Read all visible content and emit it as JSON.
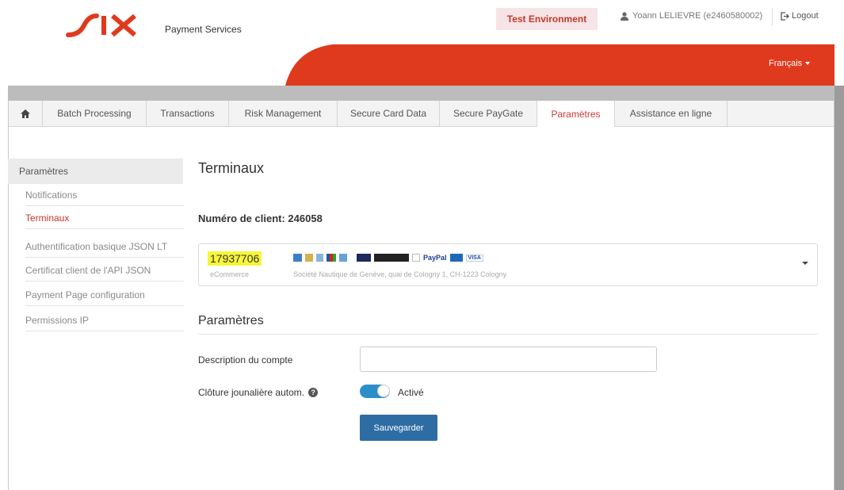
{
  "header": {
    "subtitle": "Payment Services",
    "environment": "Test Environment",
    "user": "Yoann LELIEVRE (e2460580002)",
    "logout": "Logout",
    "language": "Français"
  },
  "nav": {
    "tabs": [
      {
        "label": "Batch Processing",
        "active": false
      },
      {
        "label": "Transactions",
        "active": false
      },
      {
        "label": "Risk Management",
        "active": false
      },
      {
        "label": "Secure Card Data",
        "active": false
      },
      {
        "label": "Secure PayGate",
        "active": false
      },
      {
        "label": "Paramètres",
        "active": true
      },
      {
        "label": "Assistance en ligne",
        "active": false
      }
    ]
  },
  "sidebar": {
    "heading": "Paramètres",
    "items": [
      {
        "label": "Notifications",
        "active": false
      },
      {
        "label": "Terminaux",
        "active": true
      },
      {
        "label": "Authentification basique JSON LT",
        "active": false
      },
      {
        "label": "Certificat client de l'API JSON",
        "active": false
      },
      {
        "label": "Payment Page configuration",
        "active": false
      },
      {
        "label": "Permissions IP",
        "active": false
      }
    ]
  },
  "main": {
    "title": "Terminaux",
    "client_label": "Numéro de client:",
    "client_number": "246058",
    "terminal": {
      "id": "17937706",
      "type": "eCommerce",
      "address": "Société Nautique de Genève, quai de Cologny 1, CH-1223 Cologny",
      "paypal": "PayPal",
      "visa": "VISA"
    },
    "section_title": "Paramètres",
    "description_label": "Description du compte",
    "description_value": "",
    "auto_close_label": "Clôture jounalière autom.",
    "toggle_state": "Activé",
    "save_label": "Sauvegarder"
  },
  "colors": {
    "brand_red": "#e03a1e",
    "active_tab": "#d03a3a",
    "button": "#2e6da4",
    "toggle": "#2d8fc9",
    "highlight": "#f8f53a"
  },
  "icons": [
    "six-logo",
    "user-icon",
    "logout-icon",
    "home-icon",
    "caret-down-icon",
    "info-icon",
    "card-brand-icons"
  ]
}
